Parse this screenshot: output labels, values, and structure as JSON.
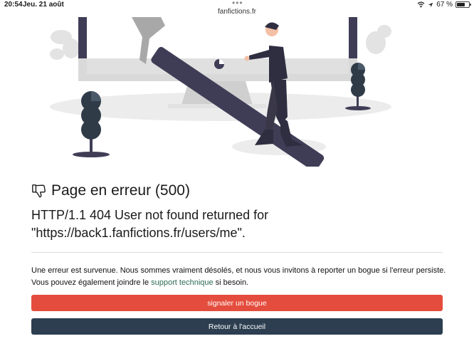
{
  "statusbar": {
    "time": "20:54",
    "date": "Jeu. 21 août",
    "url": "fanfictions.fr",
    "battery": "67 %",
    "icons": [
      "wifi-icon",
      "location-icon",
      "battery-icon"
    ]
  },
  "page": {
    "title": "Page en erreur (500)",
    "title_icon": "thumbs-down-icon",
    "error_message": "HTTP/1.1 404 User not found returned for \"https://back1.fanfictions.fr/users/me\".",
    "description_before": "Une erreur est survenue. Nous sommes vraiment désolés, et nous vous invitons à reporter un bogue si l'erreur persiste. Vous pouvez également joindre le ",
    "support_link": "support technique",
    "description_after": " si besoin."
  },
  "buttons": {
    "report_label": "signaler un bogue",
    "home_label": "Retour à l'accueil"
  },
  "colors": {
    "report": "#e44d3d",
    "home": "#2c3e50",
    "link": "#2c6b53",
    "illustration_dark": "#3f3d56",
    "illustration_light": "#e6e6e6"
  }
}
